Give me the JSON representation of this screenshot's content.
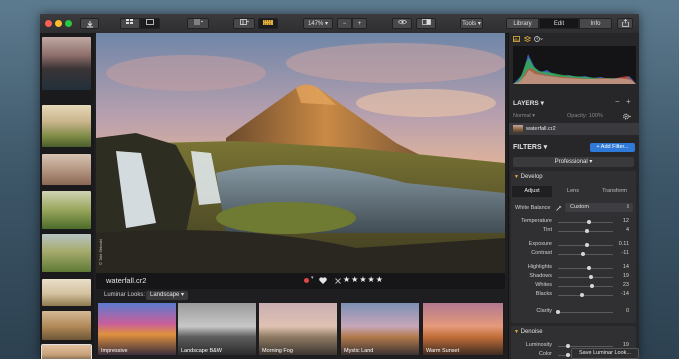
{
  "toolbar": {
    "zoom": "147%",
    "zoom_minus": "−",
    "zoom_plus": "+",
    "tools": "Tools",
    "tabs": [
      "Library",
      "Edit",
      "Info"
    ]
  },
  "image": {
    "filename": "waterfall.cr2",
    "rating_stars": "★★★★★",
    "watermark": "© Tobi Shinobi"
  },
  "looks": {
    "label": "Luminar Looks:",
    "category": "Landscape",
    "items": [
      "Impressive",
      "Landscape B&W",
      "Morning Fog",
      "Mystic Land",
      "Warm Sunset"
    ]
  },
  "layers": {
    "title": "LAYERS",
    "blend": "Normal",
    "opacity": "Opacity: 100%",
    "layer_name": "waterfall.cr2"
  },
  "filters": {
    "title": "FILTERS",
    "add_button": "+ Add Filter...",
    "workspace": "Professional"
  },
  "develop": {
    "title": "Develop",
    "tabs": [
      "Adjust",
      "Lens",
      "Transform"
    ],
    "white_balance_label": "White Balance",
    "white_balance_value": "Custom",
    "sliders": [
      {
        "label": "Temperature",
        "value": "12",
        "level": 0.56
      },
      {
        "label": "Tint",
        "value": "4",
        "level": 0.52
      },
      {
        "label": "Exposure",
        "value": "0.11",
        "level": 0.52
      },
      {
        "label": "Contrast",
        "value": "-11",
        "level": 0.45
      },
      {
        "label": "Highlights",
        "value": "14",
        "level": 0.57
      },
      {
        "label": "Shadows",
        "value": "19",
        "level": 0.6
      },
      {
        "label": "Whites",
        "value": "23",
        "level": 0.62
      },
      {
        "label": "Blacks",
        "value": "-14",
        "level": 0.43
      },
      {
        "label": "Clarity",
        "value": "0",
        "level": 0.0
      }
    ]
  },
  "denoise": {
    "title": "Denoise",
    "sliders": [
      {
        "label": "Luminosity",
        "value": "19",
        "level": 0.19
      },
      {
        "label": "Color",
        "value": "19",
        "level": 0.19
      }
    ]
  },
  "save_look": "Save Luminar Look..."
}
